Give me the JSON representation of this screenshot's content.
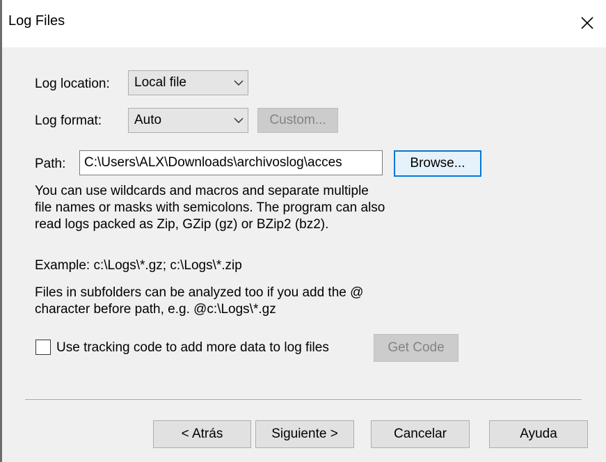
{
  "window": {
    "title": "Log Files",
    "close_glyph": "✕"
  },
  "log_location": {
    "label": "Log location:",
    "value": "Local file"
  },
  "log_format": {
    "label": "Log format:",
    "value": "Auto",
    "custom_button": "Custom..."
  },
  "path": {
    "label": "Path:",
    "value": "C:\\Users\\ALX\\Downloads\\archivoslog\\acces",
    "browse_button": "Browse..."
  },
  "help_text": {
    "line1": "You can use wildcards and macros and separate multiple",
    "line2": "file names or masks with semicolons. The program can also",
    "line3": "read logs packed as Zip, GZip (gz) or BZip2 (bz2).",
    "example": "Example: c:\\Logs\\*.gz; c:\\Logs\\*.zip",
    "subfolders1": "Files in subfolders can be analyzed too if you add the @",
    "subfolders2": "character before path, e.g. @c:\\Logs\\*.gz"
  },
  "tracking": {
    "label": "Use tracking code to add more data to log files",
    "checked": false,
    "get_code_button": "Get Code"
  },
  "footer": {
    "back_button": "< Atrás",
    "next_button": "Siguiente >",
    "cancel_button": "Cancelar",
    "help_button": "Ayuda"
  },
  "icons": {
    "close": "close-icon",
    "dropdown": "chevron-down-icon"
  }
}
